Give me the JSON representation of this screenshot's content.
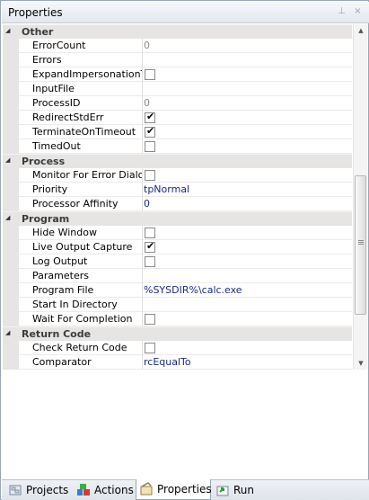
{
  "window": {
    "title": "Properties",
    "pin_glyph": "⊥",
    "close_glyph": "×"
  },
  "categories": [
    {
      "label": "Other",
      "rows": [
        {
          "name": "ErrorCount",
          "value": "0",
          "gray": true
        },
        {
          "name": "Errors",
          "value": ""
        },
        {
          "name": "ExpandImpersonationTok",
          "checkbox": true,
          "checked": false
        },
        {
          "name": "InputFile",
          "value": ""
        },
        {
          "name": "ProcessID",
          "value": "0",
          "gray": true
        },
        {
          "name": "RedirectStdErr",
          "checkbox": true,
          "checked": true
        },
        {
          "name": "TerminateOnTimeout",
          "checkbox": true,
          "checked": true
        },
        {
          "name": "TimedOut",
          "checkbox": true,
          "checked": false
        }
      ]
    },
    {
      "label": "Process",
      "rows": [
        {
          "name": "Monitor For Error Dialogs",
          "checkbox": true,
          "checked": false
        },
        {
          "name": "Priority",
          "value": "tpNormal"
        },
        {
          "name": "Processor Affinity",
          "value": "0"
        }
      ]
    },
    {
      "label": "Program",
      "rows": [
        {
          "name": "Hide Window",
          "checkbox": true,
          "checked": false
        },
        {
          "name": "Live Output Capture",
          "checkbox": true,
          "checked": true
        },
        {
          "name": "Log Output",
          "checkbox": true,
          "checked": false
        },
        {
          "name": "Parameters",
          "value": ""
        },
        {
          "name": "Program File",
          "value": "%SYSDIR%\\calc.exe"
        },
        {
          "name": "Start In Directory",
          "value": ""
        },
        {
          "name": "Wait For Completion",
          "checkbox": true,
          "checked": false
        }
      ]
    },
    {
      "label": "Return Code",
      "rows": [
        {
          "name": "Check Return Code",
          "checkbox": true,
          "checked": false
        },
        {
          "name": "Comparator",
          "value": "rcEqualTo"
        }
      ]
    }
  ],
  "check_glyph": "✔",
  "tabs": [
    {
      "label": "Projects",
      "icon": "projects-icon",
      "active": false
    },
    {
      "label": "Actions",
      "icon": "actions-icon",
      "active": false
    },
    {
      "label": "Properties",
      "icon": "properties-icon",
      "active": true
    },
    {
      "label": "Run",
      "icon": "run-icon",
      "active": false
    }
  ],
  "colors": {
    "value_text": "#1a2a8a",
    "category_bg": "#e7e5e3"
  }
}
